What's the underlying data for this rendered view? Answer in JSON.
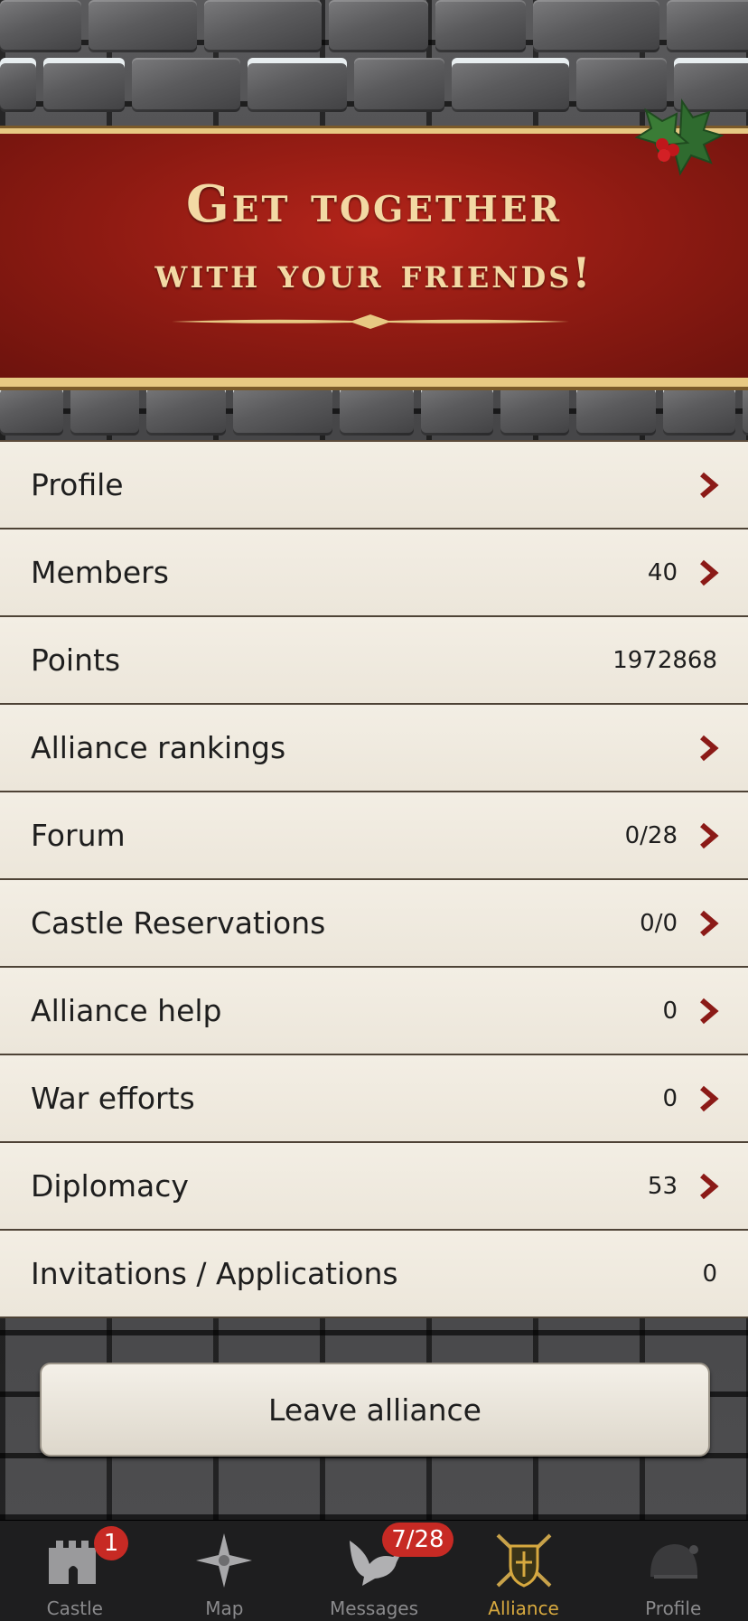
{
  "banner": {
    "title_line1": "Get together",
    "title_line2": "with your friends!"
  },
  "menu": [
    {
      "label": "Profile",
      "value": "",
      "chevron": true
    },
    {
      "label": "Members",
      "value": "40",
      "chevron": true
    },
    {
      "label": "Points",
      "value": "1972868",
      "chevron": false
    },
    {
      "label": "Alliance rankings",
      "value": "",
      "chevron": true
    },
    {
      "label": "Forum",
      "value": "0/28",
      "chevron": true
    },
    {
      "label": "Castle Reservations",
      "value": "0/0",
      "chevron": true
    },
    {
      "label": "Alliance help",
      "value": "0",
      "chevron": true
    },
    {
      "label": "War efforts",
      "value": "0",
      "chevron": true
    },
    {
      "label": "Diplomacy",
      "value": "53",
      "chevron": true
    },
    {
      "label": "Invitations / Applications",
      "value": "0",
      "chevron": false
    }
  ],
  "leave_button": "Leave alliance",
  "tabbar": {
    "castle": {
      "label": "Castle",
      "badge": "1",
      "icon": "castle-icon"
    },
    "map": {
      "label": "Map",
      "icon": "compass-icon"
    },
    "messages": {
      "label": "Messages",
      "badge": "7/28",
      "icon": "dove-icon"
    },
    "alliance": {
      "label": "Alliance",
      "icon": "shield-swords-icon"
    },
    "profile": {
      "label": "Profile",
      "icon": "helmet-icon"
    }
  },
  "colors": {
    "banner_red": "#9b1f16",
    "gold": "#e7c983",
    "chevron": "#8b1a17",
    "badge": "#c72a24",
    "active_tab": "#d7a93f"
  }
}
